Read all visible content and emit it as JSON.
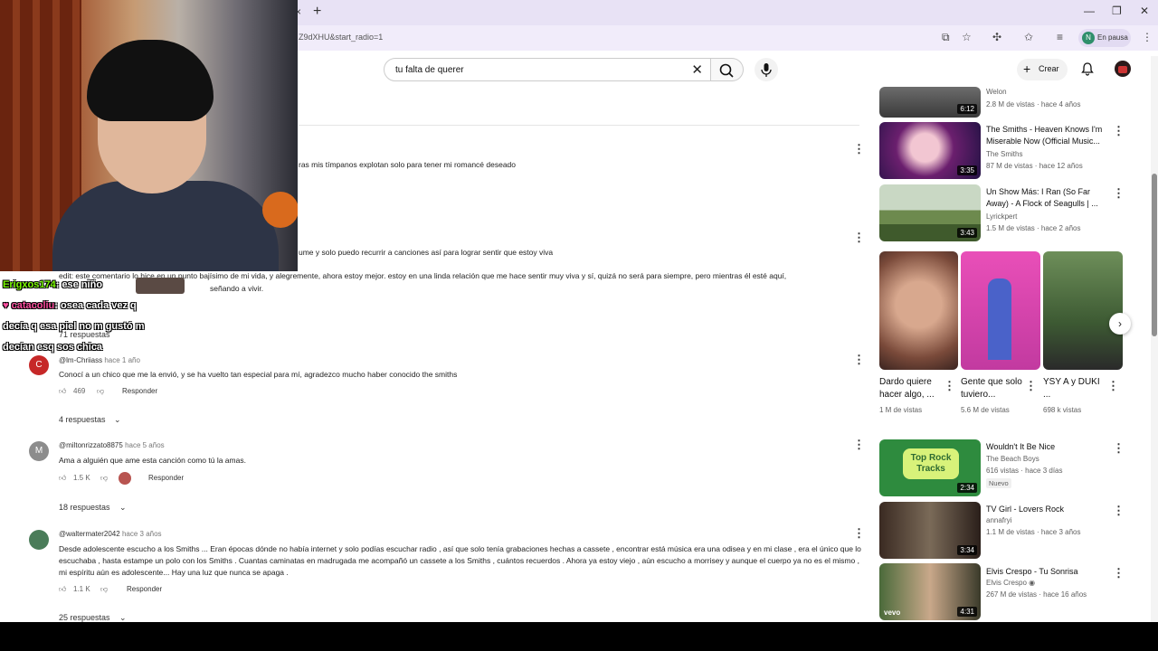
{
  "browser": {
    "tab_close": "×",
    "newtab": "+",
    "url": "Z9dXHU&start_radio=1",
    "profile_initial": "N",
    "profile_label": "En pausa",
    "win_min": "—",
    "win_restore": "❐",
    "win_close": "✕"
  },
  "header": {
    "search_query": "tu falta de querer",
    "create_label": "Crear"
  },
  "comments": {
    "fragment1": "ras mis tímpanos explotan solo para tener mi romancé deseado",
    "fragment2": "ume y solo puedo recurrir a canciones así para lograr sentir que estoy viva",
    "fragment3": "edit: este comentario lo hice en un punto bajísimo de mi vida, y alegremente, ahora estoy mejor. estoy en una linda relación que me hace sentir muy viva y sí, quizá no será para siempre, pero mientras él esté aquí,",
    "fragment4": "señando a vivir.",
    "replies_71": "71 respuestas",
    "c1": {
      "avatar": "C",
      "handle": "@lm-Chriiass",
      "ago": "hace 1 año",
      "text": "Conocí a un chico que me la envió, y se ha vuelto tan especial para mí, agradezco mucho haber conocido the smiths",
      "likes": "469",
      "reply": "Responder",
      "replies": "4 respuestas"
    },
    "c2": {
      "avatar": "M",
      "handle": "@miltonrizzato8875",
      "ago": "hace 5 años",
      "text": "Ama a alguién que ame esta canción como tú la amas.",
      "likes": "1.5 K",
      "reply": "Responder",
      "replies": "18 respuestas"
    },
    "c3": {
      "handle": "@waltermater2042",
      "ago": "hace 3 años",
      "text": "Desde adolescente escucho a los Smiths ... Eran épocas dónde no había internet y solo podías escuchar radio , así que solo tenía grabaciones hechas a cassete , encontrar está música era una odisea y en mi clase , era el único que lo escuchaba , hasta  estampe un polo con los Smiths .  Cuantas caminatas en madrugada me acompañó un cassete a los Smiths , cuántos recuerdos . Ahora ya estoy viejo , aún escucho a morrisey y aunque el cuerpo ya no es el mismo , mi espíritu aún es adolescente... Hay una luz que nunca se apaga .",
      "likes": "1.1 K",
      "reply": "Responder",
      "replies": "25 respuestas"
    }
  },
  "chat": {
    "line1_user": "Erigxos174",
    "line1_msg": ": ese niño",
    "line2_user": "catacoliu",
    "line2_msg": ": osea cada vez q",
    "line3": "decía q esa piel no m gustó m",
    "line4": "decían esq sos chica"
  },
  "sidebar": {
    "v0": {
      "channel": "Welon",
      "meta": "2.8 M de vistas · hace 4 años",
      "duration": "6:12"
    },
    "v1": {
      "title": "The Smiths - Heaven Knows I'm Miserable Now (Official Music...",
      "channel": "The Smiths",
      "meta": "87 M de vistas · hace 12 años",
      "duration": "3:35"
    },
    "v2": {
      "title": "Un Show Más: I Ran (So Far Away) - A Flock of Seagulls | ...",
      "channel": "Lyrickpert",
      "meta": "1.5 M de vistas · hace 2 años",
      "duration": "3:43"
    },
    "shorts": [
      {
        "title": "Dardo quiere hacer algo, ...",
        "meta": "1 M de vistas"
      },
      {
        "title": "Gente que solo tuviero...",
        "meta": "5.6 M de vistas"
      },
      {
        "title": "YSY A y DUKI ...",
        "meta": "698 k vistas"
      }
    ],
    "v3": {
      "title": "Wouldn't It Be Nice",
      "channel": "The Beach Boys",
      "meta": "616 vistas · hace 3 días",
      "badge": "Nuevo",
      "duration": "2:34",
      "thumb_text": "Top Rock Tracks"
    },
    "v4": {
      "title": "TV Girl - Lovers Rock",
      "channel": "annafryi",
      "meta": "1.1 M de vistas · hace 3 años",
      "duration": "3:34"
    },
    "v5": {
      "title": "Elvis Crespo - Tu Sonrisa",
      "channel": "Elvis Crespo",
      "meta": "267 M de vistas · hace 16 años",
      "duration": "4:31",
      "thumb_text": "vevo"
    }
  }
}
